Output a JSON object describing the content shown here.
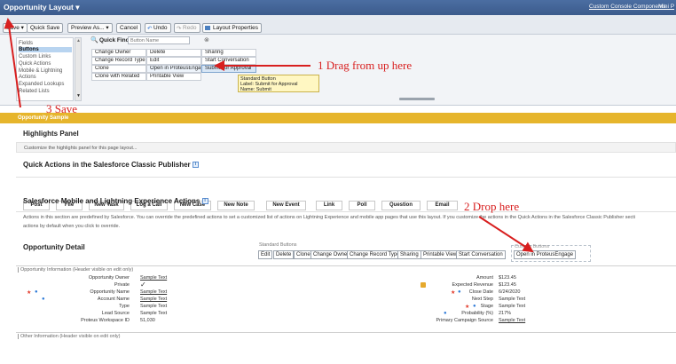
{
  "window": {
    "title": "Opportunity Layout ▾",
    "links": [
      "Custom Console Components",
      "Mini P"
    ]
  },
  "toolbar": {
    "buttons": [
      "Save ▾",
      "Quick Save",
      "Preview As... ▾",
      "Cancel",
      "Undo",
      "Redo",
      "Layout Properties"
    ]
  },
  "palette": {
    "categories": [
      "Fields",
      "Buttons",
      "Custom Links",
      "Quick Actions",
      "Mobile & Lightning",
      "Actions",
      "Expanded Lookups",
      "Related Lists"
    ],
    "quick_find_label": "Quick Find",
    "quick_find_placeholder": "Button Name",
    "items": [
      [
        "Change Owner",
        "Delete",
        "Sharing"
      ],
      [
        "Change Record Type",
        "Edit",
        "Start Conversation"
      ],
      [
        "Clone",
        "Open in ProteusEngage",
        "Submit for Approval"
      ],
      [
        "Clone with Related",
        "Printable View",
        ""
      ]
    ],
    "tooltip": [
      "Standard Button",
      "Label: Submit for Approval",
      "Name: Submit"
    ]
  },
  "sample_bar": "Opportunity Sample",
  "highlights": {
    "title": "Highlights Panel",
    "hint": "Customize the highlights panel for this page layout..."
  },
  "quick_actions": {
    "title": "Quick Actions in the Salesforce Classic Publisher",
    "buttons": [
      "Post",
      "File",
      "New Task",
      "Log a Call",
      "New Case",
      "New Note",
      "New Event",
      "Link",
      "Poll",
      "Question",
      "Email"
    ]
  },
  "mobile": {
    "title": "Salesforce Mobile and Lightning Experience Actions",
    "text1": "Actions in this section are predefined by Salesforce. You can override the predefined actions to set a customized list of actions on Lightning Experience and mobile app pages that use this layout. If you customize the actions in the Quick Actions in the Salesforce Classic Publisher secti",
    "text2": "actions by default when you click to override."
  },
  "detail": {
    "title": "Opportunity Detail",
    "standard_label": "Standard Buttons",
    "standard_buttons": [
      "Edit",
      "Delete",
      "Clone",
      "Change Owner",
      "Change Record Type",
      "Sharing",
      "Printable View",
      "Start Conversation"
    ],
    "custom_label": "Custom Buttons",
    "custom_buttons": [
      "Open in ProteusEngage"
    ],
    "section1": "Opportunity Information (Header visible on edit only)",
    "left_fields": [
      {
        "label": "Opportunity Owner",
        "value": "Sample Text"
      },
      {
        "label": "Private",
        "value": "✓"
      },
      {
        "label": "Opportunity Name",
        "value": "Sample Text"
      },
      {
        "label": "Account Name",
        "value": "Sample Text"
      },
      {
        "label": "Type",
        "value": "Sample Text"
      },
      {
        "label": "Lead Source",
        "value": "Sample Text"
      },
      {
        "label": "Proteus Workspace ID",
        "value": "51,030"
      }
    ],
    "right_fields": [
      {
        "label": "Amount",
        "value": "$123.45"
      },
      {
        "label": "Expected Revenue",
        "value": "$123.45"
      },
      {
        "label": "Close Date",
        "value": "6/24/2020"
      },
      {
        "label": "Next Step",
        "value": "Sample Text"
      },
      {
        "label": "Stage",
        "value": "Sample Text"
      },
      {
        "label": "Probability (%)",
        "value": "217%"
      },
      {
        "label": "Primary Campaign Source",
        "value": "Sample Text"
      }
    ],
    "section2": "Other Information (Header visible on edit only)"
  },
  "annotations": {
    "step1": "1 Drag from up here",
    "step2": "2 Drop here",
    "step3": "3 Save"
  },
  "colors": {
    "header": "#3c5b8c",
    "sample_bar": "#e6b52c",
    "annotation": "#d81f1f"
  }
}
